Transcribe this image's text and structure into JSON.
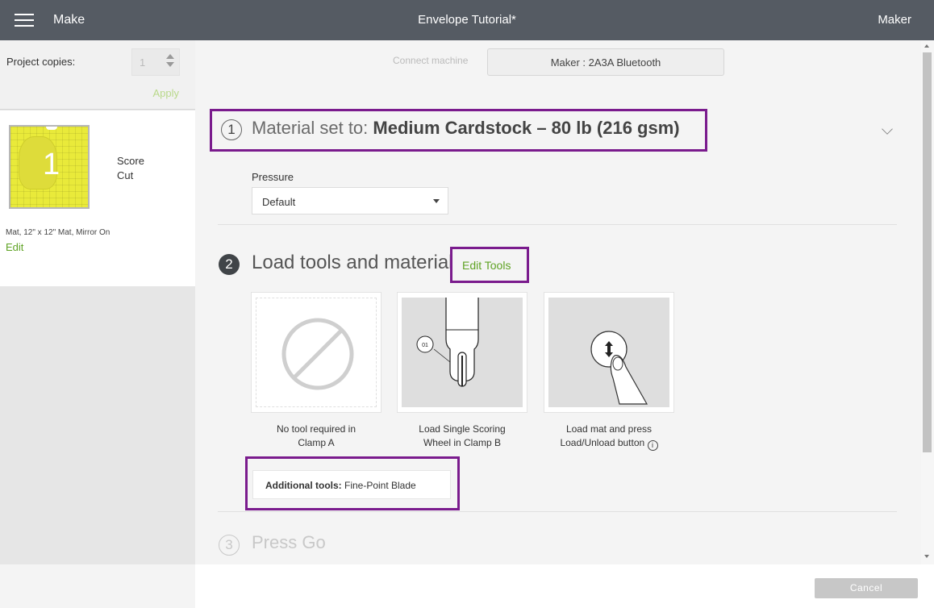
{
  "header": {
    "app_name": "Make",
    "document_title": "Envelope Tutorial*",
    "machine_name": "Maker"
  },
  "sidebar": {
    "copies_label": "Project copies:",
    "copies_value": "1",
    "apply_label": "Apply",
    "mat": {
      "number": "1",
      "operations": [
        "Score",
        "Cut"
      ],
      "info": "Mat, 12\" x 12\" Mat, Mirror On",
      "edit_label": "Edit",
      "mat_color": "#e9ea3a"
    }
  },
  "connect": {
    "label": "Connect machine",
    "device": "Maker : 2A3A Bluetooth"
  },
  "step1": {
    "number": "1",
    "prefix": "Material set to: ",
    "material": "Medium Cardstock – 80 lb (216 gsm)",
    "pressure_label": "Pressure",
    "pressure_value": "Default"
  },
  "step2": {
    "number": "2",
    "title": "Load tools and material",
    "edit_tools_label": "Edit Tools",
    "cards": [
      {
        "icon": "no-tool-icon",
        "caption_line1": "No tool required in",
        "caption_line2": "Clamp A"
      },
      {
        "icon": "scoring-wheel-icon",
        "badge": "01",
        "caption_line1": "Load Single Scoring",
        "caption_line2": "Wheel in Clamp B"
      },
      {
        "icon": "load-unload-button-icon",
        "caption_line1": "Load mat and press",
        "caption_line2": "Load/Unload button",
        "info_glyph": "i"
      }
    ],
    "additional_tools_label": "Additional tools:",
    "additional_tools_value": " Fine-Point Blade"
  },
  "step3": {
    "number": "3",
    "title": "Press Go"
  },
  "footer": {
    "cancel_label": "Cancel"
  },
  "colors": {
    "header_bg": "#555b63",
    "highlight_border": "#7a1b8d",
    "accent_green": "#5fa324"
  }
}
